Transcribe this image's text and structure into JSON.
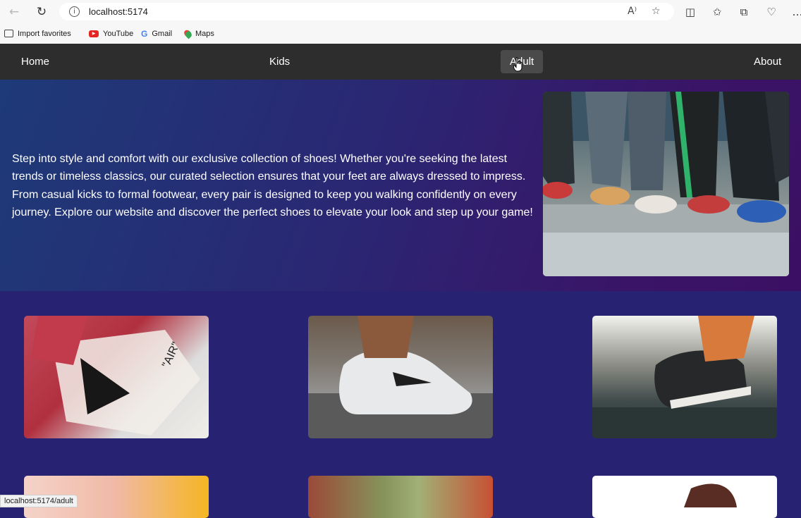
{
  "browser": {
    "url": "localhost:5174",
    "bookmarks": [
      {
        "label": "Import favorites",
        "icon": "import-icon"
      },
      {
        "label": "YouTube",
        "icon": "youtube-icon"
      },
      {
        "label": "Gmail",
        "icon": "google-icon"
      },
      {
        "label": "Maps",
        "icon": "maps-icon"
      }
    ],
    "status_url": "localhost:5174/adult"
  },
  "nav": {
    "home": "Home",
    "kids": "Kids",
    "adult": "Adult",
    "about": "About"
  },
  "hero": {
    "text": "Step into style and comfort with our exclusive collection of shoes! Whether you're seeking the latest trends or timeless classics, our curated selection ensures that your feet are always dressed to impress. From casual kicks to formal footwear, every pair is designed to keep you walking confidently on every journey. Explore our website and discover the perfect shoes to elevate your look and step up your game!"
  },
  "colors": {
    "nav_bg": "#2d2d2d",
    "page_bg": "#272272",
    "active_nav_bg": "#4a4a4a"
  }
}
